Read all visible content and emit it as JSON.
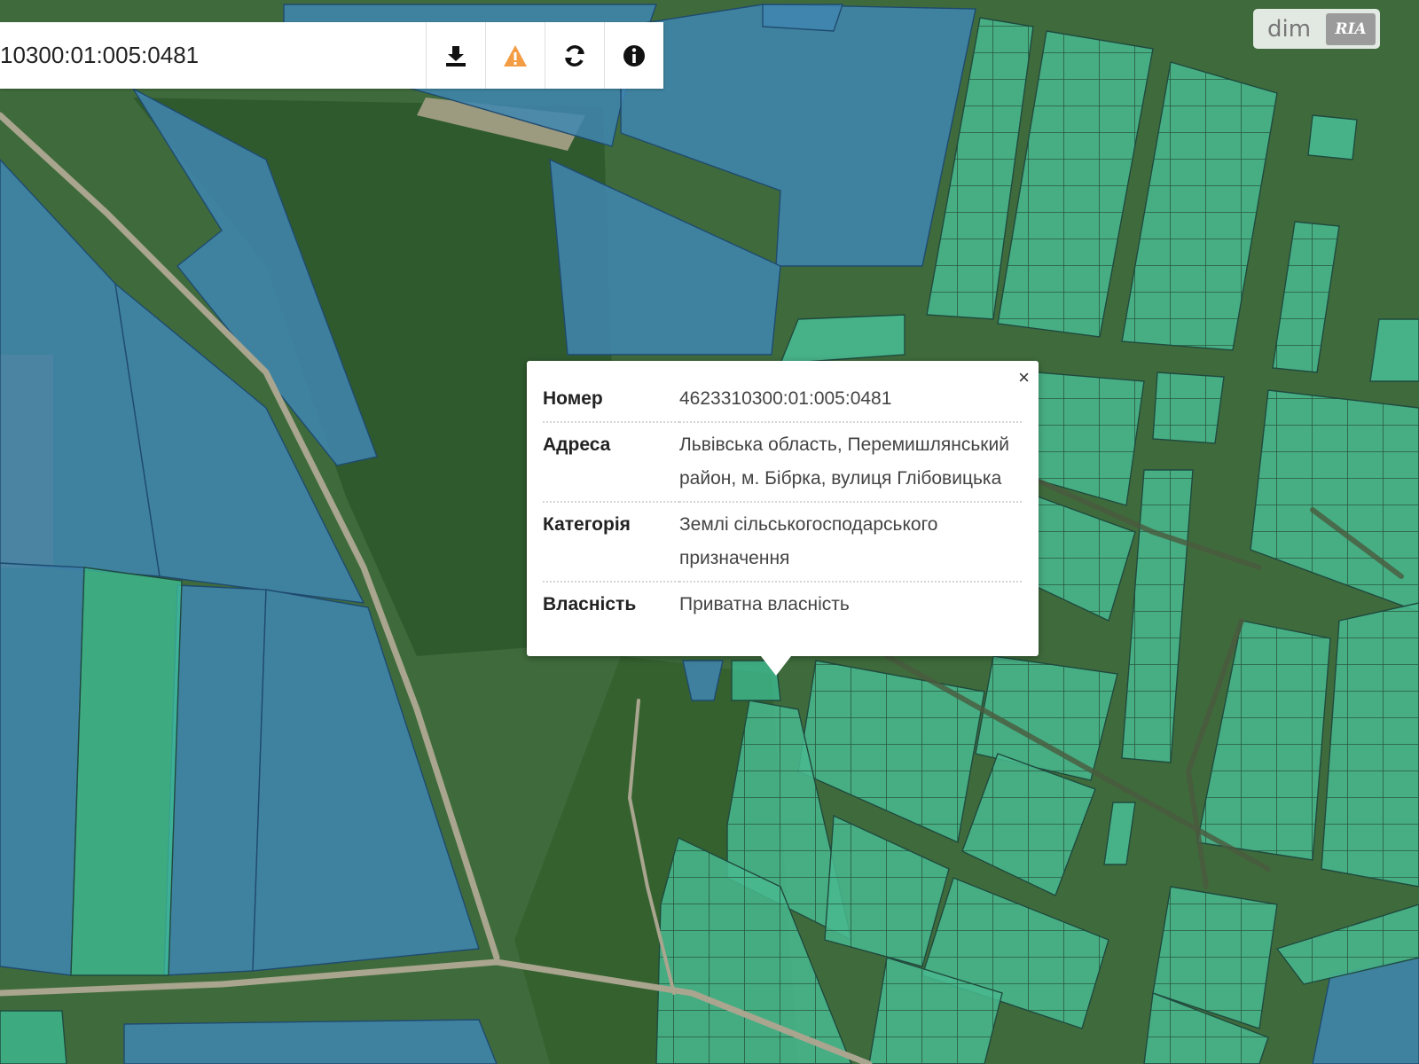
{
  "search": {
    "value": "10300:01:005:0481"
  },
  "toolbar": {
    "buttons": [
      {
        "icon": "download-icon"
      },
      {
        "icon": "warning-icon"
      },
      {
        "icon": "refresh-icon"
      },
      {
        "icon": "info-icon"
      }
    ]
  },
  "watermark": {
    "dim": "dim",
    "ria": "RIA"
  },
  "popup": {
    "close": "×",
    "rows": [
      {
        "label": "Номер",
        "value": "4623310300:01:005:0481"
      },
      {
        "label": "Адреса",
        "value": "Львівська область, Перемишлянський район, м. Бібрка, вулиця Глібовицька"
      },
      {
        "label": "Категорія",
        "value": "Землі сільськогосподарського призначення"
      },
      {
        "label": "Власність",
        "value": "Приватна власність"
      }
    ]
  },
  "colors": {
    "base": "#3f6b3c",
    "field": "#5a8a4a",
    "forest": "#2f5a2e",
    "road": "#a9a58f",
    "parcel_state": "#3f86b0",
    "parcel_private": "#3fbf96",
    "parcel_stroke": "#1f4a3e",
    "warning": "#f39c44"
  }
}
